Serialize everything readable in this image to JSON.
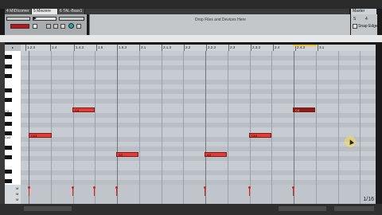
{
  "tracks": [
    {
      "label": "4 MIDIcomer",
      "selected": false
    },
    {
      "label": "5 Miezere",
      "selected": true
    },
    {
      "label": "6 TAL-Bass1",
      "selected": false
    }
  ],
  "master": {
    "label": "Master",
    "cue": "S"
  },
  "drop_zone": {
    "text": "Drop Files and Devices Here"
  },
  "clip_panel": {
    "snap_label": "Snap Edge",
    "value_label": "4"
  },
  "ruler": {
    "ticks": [
      "1.2.3",
      "1.4",
      "1.4.3",
      "1.5",
      "1.5.3",
      "2.1",
      "2.1.3",
      "2.2",
      "2.2.3",
      "2.3",
      "2.3.3",
      "2.4",
      "2.4.3",
      "3.1"
    ]
  },
  "piano": {
    "labels": [
      "C4",
      "C#3"
    ]
  },
  "notes": [
    {
      "label": "C#3"
    },
    {
      "label": "C4"
    },
    {
      "label": "A3"
    },
    {
      "label": "A3"
    },
    {
      "label": "C#3"
    },
    {
      "label": "C4"
    }
  ],
  "velocity": {
    "side_labels": [
      "M",
      "M",
      "M"
    ]
  },
  "status": {
    "page": "1/16"
  }
}
